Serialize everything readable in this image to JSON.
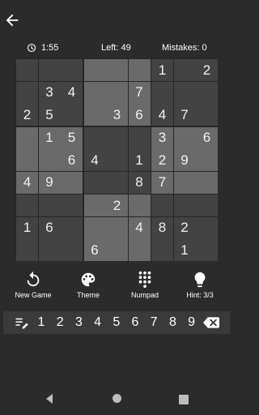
{
  "status": {
    "time": "1:55",
    "left": "Left: 49",
    "mistakes": "Mistakes: 0"
  },
  "board": [
    [
      {
        "v": "",
        "s": "d"
      },
      {
        "v": "",
        "s": "d"
      },
      {
        "v": "",
        "s": "d"
      },
      {
        "v": "",
        "s": "l"
      },
      {
        "v": "",
        "s": "l"
      },
      {
        "v": "",
        "s": "l"
      },
      {
        "v": "1",
        "s": "d"
      },
      {
        "v": "",
        "s": "d"
      },
      {
        "v": "2",
        "s": "d"
      }
    ],
    [
      {
        "v": "",
        "s": "d"
      },
      {
        "v": "3",
        "s": "d"
      },
      {
        "v": "4",
        "s": "d"
      },
      {
        "v": "",
        "s": "l"
      },
      {
        "v": "",
        "s": "l"
      },
      {
        "v": "7",
        "s": "l"
      },
      {
        "v": "",
        "s": "d"
      },
      {
        "v": "",
        "s": "d"
      },
      {
        "v": "",
        "s": "d"
      }
    ],
    [
      {
        "v": "2",
        "s": "d"
      },
      {
        "v": "5",
        "s": "d"
      },
      {
        "v": "",
        "s": "d"
      },
      {
        "v": "",
        "s": "l"
      },
      {
        "v": "3",
        "s": "l"
      },
      {
        "v": "6",
        "s": "l"
      },
      {
        "v": "4",
        "s": "d"
      },
      {
        "v": "7",
        "s": "d"
      },
      {
        "v": "",
        "s": "d"
      }
    ],
    [
      {
        "v": "",
        "s": "l"
      },
      {
        "v": "1",
        "s": "l"
      },
      {
        "v": "5",
        "s": "l"
      },
      {
        "v": "",
        "s": "d"
      },
      {
        "v": "",
        "s": "d"
      },
      {
        "v": "",
        "s": "d"
      },
      {
        "v": "3",
        "s": "l"
      },
      {
        "v": "",
        "s": "l"
      },
      {
        "v": "6",
        "s": "l"
      }
    ],
    [
      {
        "v": "",
        "s": "l"
      },
      {
        "v": "",
        "s": "l"
      },
      {
        "v": "6",
        "s": "l"
      },
      {
        "v": "4",
        "s": "d"
      },
      {
        "v": "",
        "s": "d"
      },
      {
        "v": "1",
        "s": "d"
      },
      {
        "v": "2",
        "s": "l"
      },
      {
        "v": "9",
        "s": "l"
      },
      {
        "v": "",
        "s": "l"
      }
    ],
    [
      {
        "v": "4",
        "s": "l"
      },
      {
        "v": "9",
        "s": "l"
      },
      {
        "v": "",
        "s": "l"
      },
      {
        "v": "",
        "s": "d"
      },
      {
        "v": "",
        "s": "d"
      },
      {
        "v": "8",
        "s": "d"
      },
      {
        "v": "7",
        "s": "l"
      },
      {
        "v": "",
        "s": "l"
      },
      {
        "v": "",
        "s": "l"
      }
    ],
    [
      {
        "v": "",
        "s": "d"
      },
      {
        "v": "",
        "s": "d"
      },
      {
        "v": "",
        "s": "d"
      },
      {
        "v": "",
        "s": "l"
      },
      {
        "v": "2",
        "s": "l"
      },
      {
        "v": "",
        "s": "l"
      },
      {
        "v": "",
        "s": "d"
      },
      {
        "v": "",
        "s": "d"
      },
      {
        "v": "",
        "s": "d"
      }
    ],
    [
      {
        "v": "1",
        "s": "d"
      },
      {
        "v": "6",
        "s": "d"
      },
      {
        "v": "",
        "s": "d"
      },
      {
        "v": "",
        "s": "l"
      },
      {
        "v": "",
        "s": "l"
      },
      {
        "v": "4",
        "s": "l"
      },
      {
        "v": "8",
        "s": "d"
      },
      {
        "v": "2",
        "s": "d"
      },
      {
        "v": "",
        "s": "d"
      }
    ],
    [
      {
        "v": "",
        "s": "d"
      },
      {
        "v": "",
        "s": "d"
      },
      {
        "v": "",
        "s": "d"
      },
      {
        "v": "6",
        "s": "l"
      },
      {
        "v": "",
        "s": "l"
      },
      {
        "v": "",
        "s": "l"
      },
      {
        "v": "",
        "s": "d"
      },
      {
        "v": "1",
        "s": "d"
      },
      {
        "v": "",
        "s": "d"
      }
    ]
  ],
  "actions": {
    "new_game": "New Game",
    "theme": "Theme",
    "numpad": "Numpad",
    "hint": "Hint: 3/3"
  },
  "numbers": [
    "1",
    "2",
    "3",
    "4",
    "5",
    "6",
    "7",
    "8",
    "9"
  ],
  "icons": {
    "back": "arrow-left-icon",
    "clock": "clock-icon",
    "new_game": "refresh-icon",
    "theme": "palette-icon",
    "numpad": "dialpad-icon",
    "hint": "lightbulb-icon",
    "notes": "pencil-notes-icon",
    "erase": "backspace-icon"
  },
  "colors": {
    "background": "#2b2b2b",
    "cell_light": "#6a6a6a",
    "cell_dark": "#434343",
    "text": "#ffffff"
  }
}
